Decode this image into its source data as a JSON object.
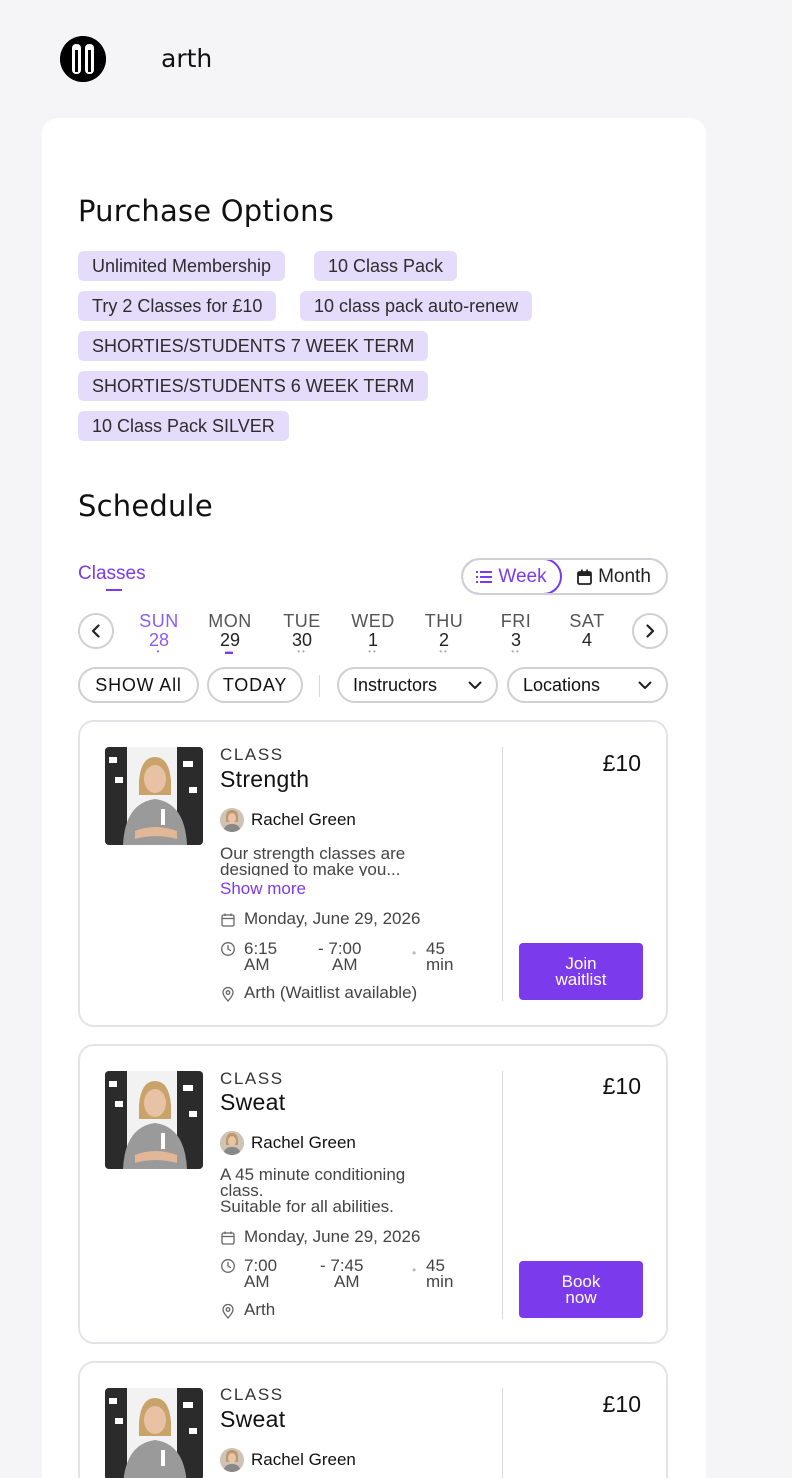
{
  "brand": {
    "name": "arth"
  },
  "purchase": {
    "title": "Purchase Options",
    "options": [
      "Unlimited Membership",
      "10 Class Pack",
      "Try 2 Classes for £10",
      "10 class pack auto-renew",
      "SHORTIES/STUDENTS 7 WEEK TERM",
      "SHORTIES/STUDENTS 6 WEEK TERM",
      "10 Class Pack SILVER"
    ]
  },
  "schedule": {
    "title": "Schedule",
    "tab": "Classes",
    "view": {
      "week": "Week",
      "month": "Month",
      "selected": "Week"
    },
    "days": [
      {
        "name": "SUN",
        "num": "28"
      },
      {
        "name": "MON",
        "num": "29"
      },
      {
        "name": "TUE",
        "num": "30"
      },
      {
        "name": "WED",
        "num": "1"
      },
      {
        "name": "THU",
        "num": "2"
      },
      {
        "name": "FRI",
        "num": "3"
      },
      {
        "name": "SAT",
        "num": "4"
      }
    ],
    "filters": {
      "show_all": "SHOW All",
      "today": "TODAY",
      "instructors": "Instructors",
      "locations": "Locations"
    }
  },
  "classes": [
    {
      "label": "CLASS",
      "name": "Strength",
      "instructor": "Rachel Green",
      "desc1": "Our strength classes are",
      "desc2": "designed to make you...",
      "show_more": "Show more",
      "date": "Monday, June 29, 2026",
      "start_time": "6:15",
      "start_ampm": "AM",
      "end_time": "- 7:00",
      "end_ampm": "AM",
      "dur_num": "45",
      "dur_unit": "min",
      "location": "Arth (Waitlist available)",
      "price": "£10",
      "cta1": "Join",
      "cta2": "waitlist"
    },
    {
      "label": "CLASS",
      "name": "Sweat",
      "instructor": "Rachel Green",
      "desc1": "A 45 minute conditioning",
      "desc2": "class.",
      "desc3": "Suitable for all abilities.",
      "date": "Monday, June 29, 2026",
      "start_time": "7:00",
      "start_ampm": "AM",
      "end_time": "- 7:45",
      "end_ampm": "AM",
      "dur_num": "45",
      "dur_unit": "min",
      "location": "Arth",
      "price": "£10",
      "cta1": "Book",
      "cta2": "now"
    },
    {
      "label": "CLASS",
      "name": "Sweat",
      "instructor": "Rachel Green",
      "price": "£10"
    }
  ],
  "colors": {
    "accent": "#7c3aed",
    "chip_bg": "#e5dcfb",
    "page_bg": "#f5f5f7"
  }
}
